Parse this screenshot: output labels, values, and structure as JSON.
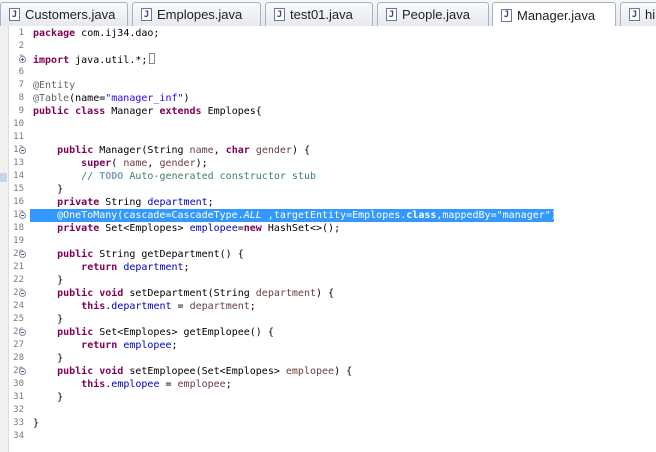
{
  "tabs": [
    {
      "label": "Customers.java"
    },
    {
      "label": "Emplopes.java"
    },
    {
      "label": "test01.java"
    },
    {
      "label": "People.java"
    },
    {
      "label": "Manager.java"
    },
    {
      "label": "hib"
    }
  ],
  "active_tab": 4,
  "lines": [
    {
      "n": "1",
      "code": "package com.ij34.dao;"
    },
    {
      "n": "2",
      "code": ""
    },
    {
      "n": "3",
      "code": "import java.util.*;"
    },
    {
      "n": "6",
      "code": ""
    },
    {
      "n": "7",
      "code": "@Entity"
    },
    {
      "n": "8",
      "code": "@Table(name=\"manager_inf\")"
    },
    {
      "n": "9",
      "code": "public class Manager extends Emplopes{"
    },
    {
      "n": "10",
      "code": ""
    },
    {
      "n": "11",
      "code": ""
    },
    {
      "n": "12",
      "code": "    public Manager(String name, char gender) {"
    },
    {
      "n": "13",
      "code": "        super( name, gender);"
    },
    {
      "n": "14",
      "code": "        // TODO Auto-generated constructor stub"
    },
    {
      "n": "15",
      "code": "    }"
    },
    {
      "n": "16",
      "code": "    private String department;"
    },
    {
      "n": "17",
      "code": "    @OneToMany(cascade=CascadeType.ALL ,targetEntity=Emplopes.class,mappedBy=\"manager\")"
    },
    {
      "n": "18",
      "code": "    private Set<Emplopes> emplopee=new HashSet<>();"
    },
    {
      "n": "19",
      "code": ""
    },
    {
      "n": "20",
      "code": "    public String getDepartment() {"
    },
    {
      "n": "21",
      "code": "        return department;"
    },
    {
      "n": "22",
      "code": "    }"
    },
    {
      "n": "23",
      "code": "    public void setDepartment(String department) {"
    },
    {
      "n": "24",
      "code": "        this.department = department;"
    },
    {
      "n": "25",
      "code": "    }"
    },
    {
      "n": "26",
      "code": "    public Set<Emplopes> getEmplopee() {"
    },
    {
      "n": "27",
      "code": "        return emplopee;"
    },
    {
      "n": "28",
      "code": "    }"
    },
    {
      "n": "29",
      "code": "    public void setEmplopee(Set<Emplopes> emplopee) {"
    },
    {
      "n": "30",
      "code": "        this.emplopee = emplopee;"
    },
    {
      "n": "31",
      "code": "    }"
    },
    {
      "n": "32",
      "code": ""
    },
    {
      "n": "33",
      "code": "}"
    },
    {
      "n": "34",
      "code": ""
    }
  ],
  "selected_line": "17",
  "colors": {
    "keyword": "#7f0055",
    "string": "#2a00ff",
    "field": "#0000c0",
    "comment": "#3f7f5f",
    "annotation": "#646464",
    "selection": "#3399ff"
  }
}
